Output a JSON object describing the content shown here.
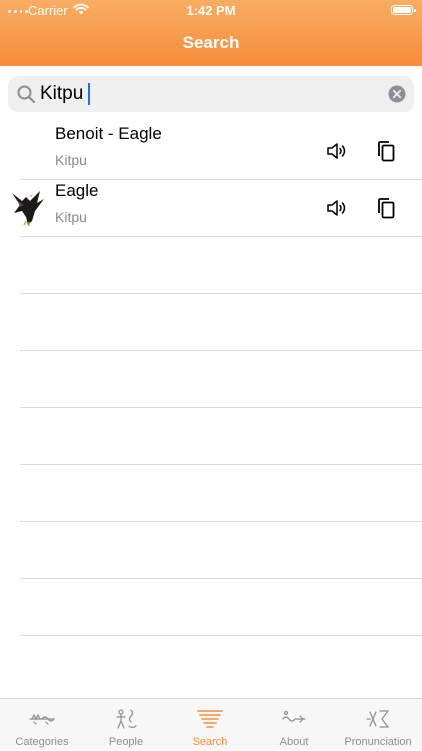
{
  "status_bar": {
    "carrier": "Carrier",
    "time": "1:42 PM"
  },
  "nav": {
    "title": "Search"
  },
  "search": {
    "value": "Kitpu",
    "placeholder": ""
  },
  "results": [
    {
      "title": "Benoit - Eagle",
      "subtitle": "Kitpu",
      "has_image": false
    },
    {
      "title": "Eagle",
      "subtitle": "Kitpu",
      "has_image": true
    }
  ],
  "icons": {
    "search": "search-icon",
    "clear": "clear-icon",
    "speaker": "speaker-icon",
    "copy": "copy-icon"
  },
  "colors": {
    "accent": "#f68d3a",
    "header_top": "#f9ad62",
    "header_bottom": "#f68d3a",
    "tab_inactive": "#8e8e93"
  },
  "tabs": [
    {
      "label": "Categories",
      "icon": "categories-icon",
      "active": false
    },
    {
      "label": "People",
      "icon": "people-icon",
      "active": false
    },
    {
      "label": "Search",
      "icon": "search-tab-icon",
      "active": true
    },
    {
      "label": "About",
      "icon": "about-icon",
      "active": false
    },
    {
      "label": "Pronunciation",
      "icon": "pronunciation-icon",
      "active": false
    }
  ]
}
